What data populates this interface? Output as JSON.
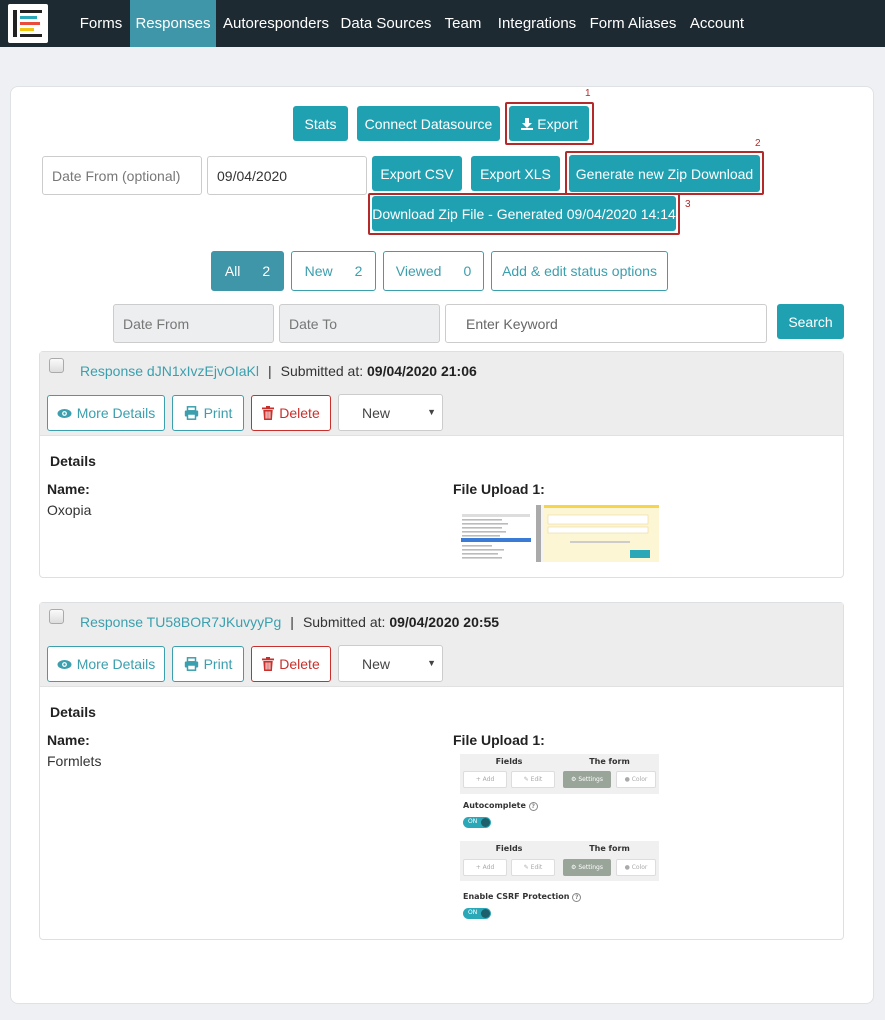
{
  "nav": {
    "items": [
      "Forms",
      "Responses",
      "Autoresponders",
      "Data Sources",
      "Team",
      "Integrations",
      "Form Aliases",
      "Account"
    ],
    "active": "Responses"
  },
  "toolbar": {
    "stats": "Stats",
    "connect_datasource": "Connect Datasource",
    "export": "Export",
    "date_from_placeholder": "Date From (optional)",
    "date_to_value": "09/04/2020",
    "export_csv": "Export CSV",
    "export_xls": "Export XLS",
    "generate_zip": "Generate new Zip Download",
    "download_zip": "Download Zip File - Generated 09/04/2020 14:14",
    "callouts": [
      "1",
      "2",
      "3"
    ]
  },
  "filters": {
    "tabs": [
      {
        "label": "All",
        "count": "2"
      },
      {
        "label": "New",
        "count": "2"
      },
      {
        "label": "Viewed",
        "count": "0"
      }
    ],
    "status_options": "Add & edit status options",
    "date_from": "Date From",
    "date_to": "Date To",
    "keyword_placeholder": "Enter Keyword",
    "search": "Search"
  },
  "responses": [
    {
      "id": "Response dJN1xIvzEjvOIaKl",
      "submitted_label": "Submitted at:",
      "submitted_at": "09/04/2020 21:06",
      "more_details": "More Details",
      "print": "Print",
      "delete": "Delete",
      "status": "New",
      "details_heading": "Details",
      "name_label": "Name:",
      "name_value": "Oxopia",
      "upload_label": "File Upload 1:"
    },
    {
      "id": "Response TU58BOR7JKuvyyPg",
      "submitted_label": "Submitted at:",
      "submitted_at": "09/04/2020 20:55",
      "more_details": "More Details",
      "print": "Print",
      "delete": "Delete",
      "status": "New",
      "details_heading": "Details",
      "name_label": "Name:",
      "name_value": "Formlets",
      "upload_label": "File Upload 1:",
      "thumb": {
        "fields": "Fields",
        "the_form": "The form",
        "add": "Add",
        "edit": "Edit",
        "settings": "Settings",
        "color": "Color",
        "autocomplete": "Autocomplete",
        "csrf": "Enable CSRF Protection",
        "on": "ON"
      }
    }
  ],
  "colors": {
    "nav_bg": "#1e2a32",
    "accent": "#20a1b2",
    "active_tab": "#3f96a8",
    "danger": "#c9302c",
    "callout": "#b22a2a"
  }
}
